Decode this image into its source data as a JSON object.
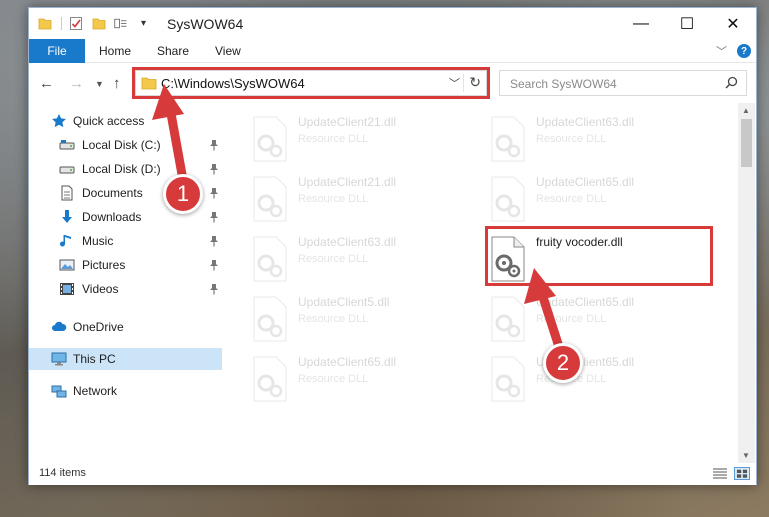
{
  "window": {
    "title": "SysWOW64",
    "controls": {
      "minimize": "—",
      "maximize": "☐",
      "close": "✕"
    }
  },
  "ribbon": {
    "tabs": [
      "File",
      "Home",
      "Share",
      "View"
    ],
    "help": "?"
  },
  "nav": {
    "address": "C:\\Windows\\SysWOW64",
    "search_placeholder": "Search SysWOW64"
  },
  "sidebar": {
    "items": [
      {
        "label": "Quick access",
        "icon": "star-icon",
        "pinned": false
      },
      {
        "label": "Local Disk (C:)",
        "icon": "drive-icon",
        "pinned": true
      },
      {
        "label": "Local Disk (D:)",
        "icon": "drive-icon",
        "pinned": true
      },
      {
        "label": "Documents",
        "icon": "documents-icon",
        "pinned": true
      },
      {
        "label": "Downloads",
        "icon": "downloads-icon",
        "pinned": true
      },
      {
        "label": "Music",
        "icon": "music-icon",
        "pinned": true
      },
      {
        "label": "Pictures",
        "icon": "pictures-icon",
        "pinned": true
      },
      {
        "label": "Videos",
        "icon": "videos-icon",
        "pinned": true
      },
      {
        "label": "OneDrive",
        "icon": "onedrive-icon",
        "pinned": false
      },
      {
        "label": "This PC",
        "icon": "this-pc-icon",
        "pinned": false,
        "selected": true
      },
      {
        "label": "Network",
        "icon": "network-icon",
        "pinned": false
      }
    ]
  },
  "files": [
    {
      "name": "UpdateClient21.dll",
      "type": "Resource DLL",
      "faded": true
    },
    {
      "name": "UpdateClient63.dll",
      "type": "Resource DLL",
      "faded": true
    },
    {
      "name": "UpdateClient21.dll",
      "type": "Resource DLL",
      "faded": true
    },
    {
      "name": "UpdateClient65.dll",
      "type": "Resource DLL",
      "faded": true
    },
    {
      "name": "UpdateClient63.dll",
      "type": "Resource DLL",
      "faded": true
    },
    {
      "name": "fruity vocoder.dll",
      "type": "",
      "faded": false,
      "highlighted": true
    },
    {
      "name": "UpdateClient5.dll",
      "type": "Resource DLL",
      "faded": true
    },
    {
      "name": "UpdateClient65.dll",
      "type": "Resource DLL",
      "faded": true
    },
    {
      "name": "UpdateClient65.dll",
      "type": "Resource DLL",
      "faded": true
    },
    {
      "name": "UpdateClient65.dll",
      "type": "Resource DLL",
      "faded": true
    }
  ],
  "status": {
    "item_count": "114 items"
  },
  "annotations": {
    "step1": "1",
    "step2": "2"
  },
  "colors": {
    "accent": "#1979ca",
    "highlight": "#d63a3a",
    "selected": "#cce4f7"
  }
}
